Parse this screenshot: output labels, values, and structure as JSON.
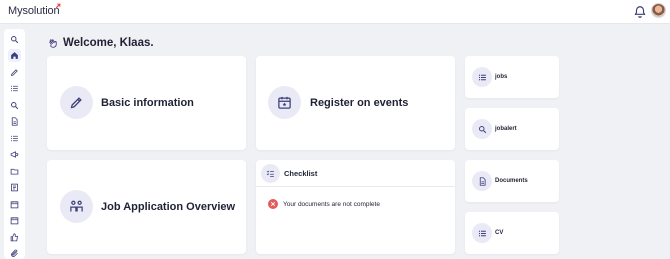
{
  "app": {
    "logo_text": "Mysolution",
    "logo_mark": "ˀ"
  },
  "header": {
    "notifications_icon": "bell-icon",
    "avatar": "user-avatar"
  },
  "sidebar": {
    "items": [
      {
        "icon": "search-icon"
      },
      {
        "icon": "home-icon",
        "active": true
      },
      {
        "icon": "pen-icon"
      },
      {
        "icon": "list-icon"
      },
      {
        "icon": "search-icon"
      },
      {
        "icon": "document-icon"
      },
      {
        "icon": "list-icon"
      },
      {
        "icon": "megaphone-icon"
      },
      {
        "icon": "folder-icon"
      },
      {
        "icon": "form-icon"
      },
      {
        "icon": "calendar-icon"
      },
      {
        "icon": "calendar-icon"
      },
      {
        "icon": "thumbs-up-icon"
      },
      {
        "icon": "paperclip-icon"
      }
    ]
  },
  "welcome": {
    "text": "Welcome, Klaas.",
    "icon": "wave-hand-icon"
  },
  "cards": {
    "basic_information": {
      "title": "Basic information",
      "icon": "pen-icon"
    },
    "register_events": {
      "title": "Register on events",
      "icon": "calendar-icon"
    },
    "job_overview": {
      "title": "Job Application Overview",
      "icon": "people-icon"
    },
    "checklist": {
      "title": "Checklist",
      "icon": "checklist-icon",
      "items": [
        {
          "text": "Your documents are not complete",
          "status": "error"
        }
      ]
    }
  },
  "quick_links": [
    {
      "label": "jobs",
      "icon": "list-icon"
    },
    {
      "label": "jobalert",
      "icon": "search-icon"
    },
    {
      "label": "Documents",
      "icon": "document-icon"
    },
    {
      "label": "CV",
      "icon": "list-icon"
    }
  ],
  "colors": {
    "accent": "#3d3f7a",
    "icon_bg": "#eaeaf6",
    "error": "#e5585b",
    "page_bg": "#f0f1f5"
  }
}
